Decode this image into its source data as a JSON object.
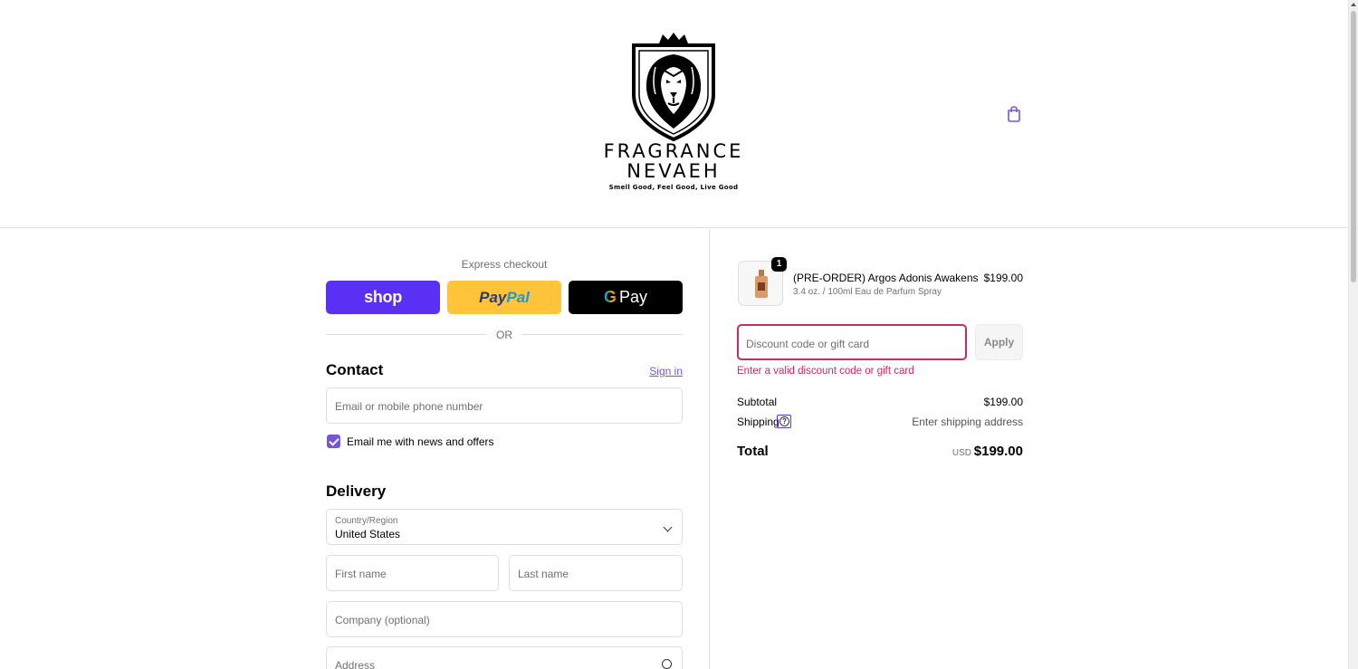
{
  "header": {
    "brand_name_line1": "FRAGRANCE",
    "brand_name_line2": "NEVAEH",
    "tagline": "Smell Good, Feel Good, Live Good"
  },
  "express": {
    "label": "Express checkout",
    "shop_label": "shop",
    "paypal_label_a": "Pay",
    "paypal_label_b": "Pal",
    "gpay_g": "G",
    "gpay_label": "Pay",
    "or_label": "OR"
  },
  "contact": {
    "title": "Contact",
    "signin_label": "Sign in",
    "email_placeholder": "Email or mobile phone number",
    "newsletter_label": "Email me with news and offers",
    "newsletter_checked": true
  },
  "delivery": {
    "title": "Delivery",
    "country_label": "Country/Region",
    "country_value": "United States",
    "first_name_placeholder": "First name",
    "last_name_placeholder": "Last name",
    "company_placeholder": "Company (optional)",
    "address_placeholder": "Address"
  },
  "order": {
    "item": {
      "quantity": "1",
      "name": "(PRE-ORDER) Argos Adonis Awakens",
      "variant": "3.4 oz. / 100ml Eau de Parfum Spray",
      "price": "$199.00"
    },
    "discount_placeholder": "Discount code or gift card",
    "apply_label": "Apply",
    "discount_error": "Enter a valid discount code or gift card",
    "subtotal_label": "Subtotal",
    "subtotal_value": "$199.00",
    "shipping_label": "Shipping",
    "shipping_value": "Enter shipping address",
    "total_label": "Total",
    "total_currency": "USD",
    "total_value": "$199.00"
  },
  "colors": {
    "accent": "#7a54d6",
    "shop_pay": "#5a31f4",
    "paypal": "#ffc439",
    "error": "#c9286b"
  },
  "icons": [
    "lion-crest-logo",
    "shopping-bag-icon",
    "chevron-down-icon",
    "search-icon",
    "question-icon",
    "checkbox-check-icon"
  ]
}
